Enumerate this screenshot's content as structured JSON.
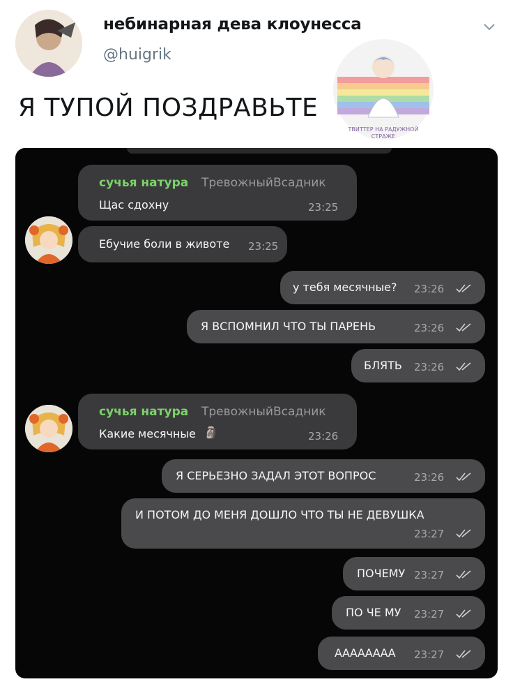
{
  "tweet": {
    "display_name": "небинарная дева клоунесса",
    "handle": "@huigrik",
    "text": "Я ТУПОЙ ПОЗДРАВЬТЕ",
    "watermark_text": "ТВИТТЕР НА РАДУЖНОЙ СТРАЖЕ"
  },
  "chat": {
    "messages": [
      {
        "dir": "in",
        "sender": "сучья натура",
        "title": "ТревожныйВсадник",
        "text": "Щас сдохну",
        "time": "23:25"
      },
      {
        "dir": "in",
        "text": "Ебучие боли в животе",
        "time": "23:25"
      },
      {
        "dir": "out",
        "text": "у тебя месячные?",
        "time": "23:26"
      },
      {
        "dir": "out",
        "text": "Я ВСПОМНИЛ ЧТО ТЫ ПАРЕНЬ",
        "time": "23:26"
      },
      {
        "dir": "out",
        "text": "БЛЯТЬ",
        "time": "23:26"
      },
      {
        "dir": "in",
        "sender": "сучья натура",
        "title": "ТревожныйВсадник",
        "text": "Какие месячные",
        "emoji": "🗿",
        "time": "23:26"
      },
      {
        "dir": "out",
        "text": "Я СЕРЬЕЗНО ЗАДАЛ ЭТОТ ВОПРОС",
        "time": "23:26"
      },
      {
        "dir": "out",
        "text": "И ПОТОМ ДО МЕНЯ ДОШЛО ЧТО ТЫ НЕ ДЕВУШКА",
        "time": "23:27"
      },
      {
        "dir": "out",
        "text": "ПОЧЕМУ",
        "time": "23:27"
      },
      {
        "dir": "out",
        "text": "ПО ЧЕ МУ",
        "time": "23:27"
      },
      {
        "dir": "out",
        "text": "АААААААА",
        "time": "23:27"
      }
    ]
  },
  "colors": {
    "sender_name": "#7bd36a",
    "chat_background": "#060606",
    "bubble": "#3a3a3c"
  }
}
